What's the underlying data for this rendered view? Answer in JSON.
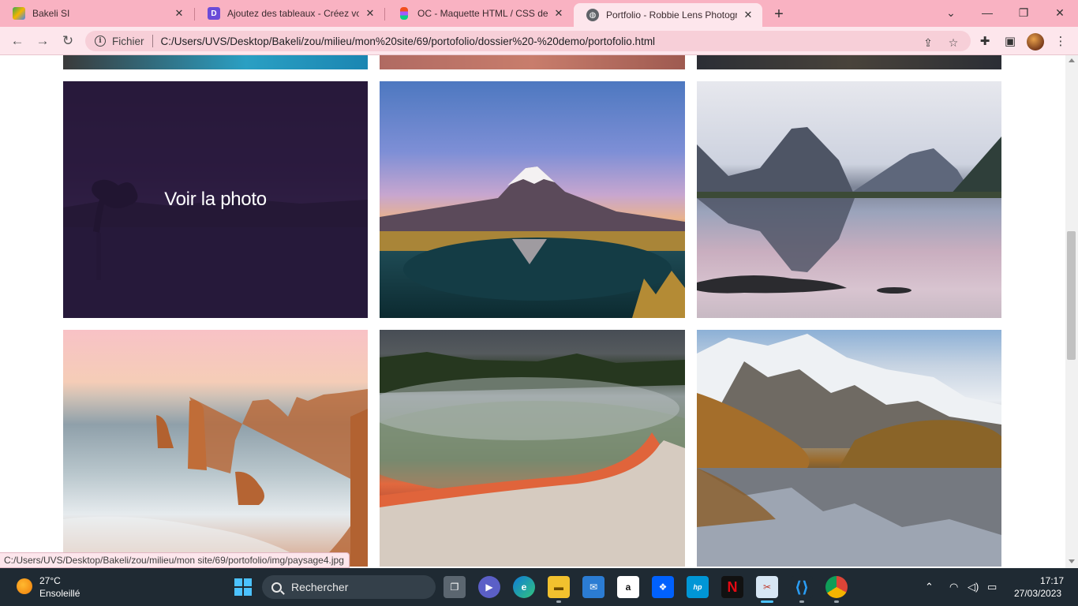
{
  "browser": {
    "tabs": [
      {
        "title": "Bakeli SI",
        "active": false
      },
      {
        "title": "Ajoutez des tableaux - Créez votre",
        "active": false
      },
      {
        "title": "OC - Maquette HTML / CSS desk",
        "active": false
      },
      {
        "title": "Portfolio - Robbie Lens Photogra",
        "active": true
      }
    ],
    "address_bar": {
      "site_info_label": "Fichier",
      "url": "C:/Users/UVS/Desktop/Bakeli/zou/milieu/mon%20site/69/portofolio/dossier%20-%20demo/portofolio.html"
    }
  },
  "page": {
    "gallery": {
      "hover_caption": "Voir la photo",
      "photos": [
        {
          "subject": "lone tree in lake at dusk",
          "hovered": true
        },
        {
          "subject": "snow-capped volcano reflected in pond",
          "hovered": false
        },
        {
          "subject": "fjord mountains reflected in water",
          "hovered": false
        },
        {
          "subject": "coastal sea stacks",
          "hovered": false
        },
        {
          "subject": "steaming geothermal pool",
          "hovered": false
        },
        {
          "subject": "snowy mountain reflected in lake",
          "hovered": false
        }
      ]
    },
    "status_bar_url": "C:/Users/UVS/Desktop/Bakeli/zou/milieu/mon site/69/portofolio/img/paysage4.jpg"
  },
  "taskbar": {
    "weather": {
      "temperature": "27°C",
      "condition": "Ensoleillé"
    },
    "search_placeholder": "Rechercher",
    "clock": {
      "time": "17:17",
      "date": "27/03/2023"
    }
  }
}
